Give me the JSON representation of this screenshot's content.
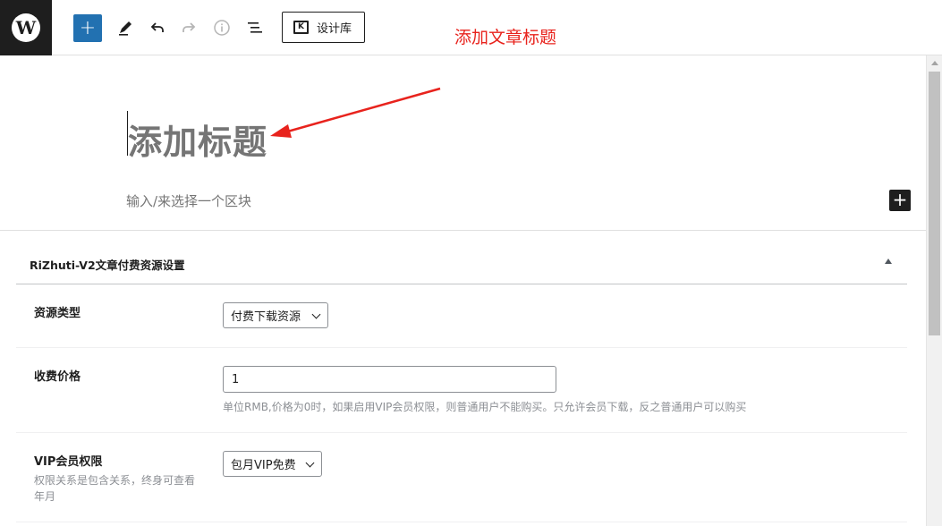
{
  "toolbar": {
    "logo_letter": "W",
    "inserter_symbol": "+",
    "design_library_label": "设计库",
    "design_library_icon_letter": "K"
  },
  "editor": {
    "title_placeholder": "添加标题",
    "block_placeholder": "输入/来选择一个区块",
    "add_block_symbol": "+"
  },
  "annotation": {
    "text": "添加文章标题",
    "color": "#e8231d"
  },
  "metabox": {
    "title": "RiZhuti-V2文章付费资源设置",
    "fields": [
      {
        "label": "资源类型",
        "value": "付费下载资源"
      },
      {
        "label": "收费价格",
        "value": "1",
        "help": "单位RMB,价格为0时，如果启用VIP会员权限，则普通用户不能购买。只允许会员下载，反之普通用户可以购买"
      },
      {
        "label": "VIP会员权限",
        "description": "权限关系是包含关系，终身可查看年月",
        "value": "包月VIP免费"
      }
    ]
  },
  "colors": {
    "accent": "#2271b1",
    "dark": "#1e1e1e"
  }
}
